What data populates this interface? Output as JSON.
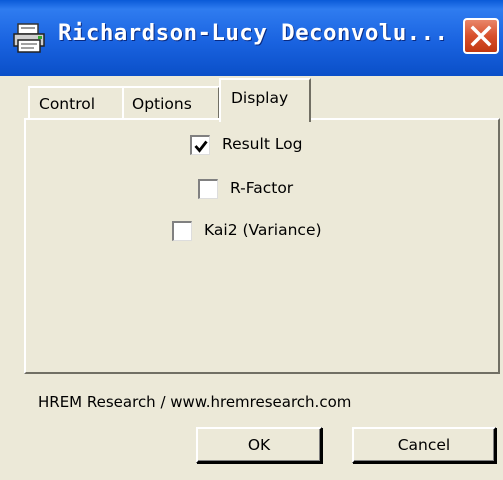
{
  "window": {
    "title": "Richardson-Lucy Deconvolu...",
    "title_icon": "printer-app-icon",
    "close_icon": "close-icon"
  },
  "tabs": [
    {
      "label": "Control",
      "selected": false
    },
    {
      "label": "Options",
      "selected": false
    },
    {
      "label": "Display",
      "selected": true
    }
  ],
  "display_options": [
    {
      "label": "Result Log",
      "checked": true
    },
    {
      "label": "R-Factor",
      "checked": false
    },
    {
      "label": "Kai2 (Variance)",
      "checked": false
    }
  ],
  "footer": {
    "credit": "HREM Research / www.hremresearch.com"
  },
  "buttons": {
    "ok": "OK",
    "cancel": "Cancel"
  },
  "colors": {
    "titlebar": "#1a63e0",
    "close_button": "#d8502c",
    "dialog_background": "#ece9d8"
  }
}
